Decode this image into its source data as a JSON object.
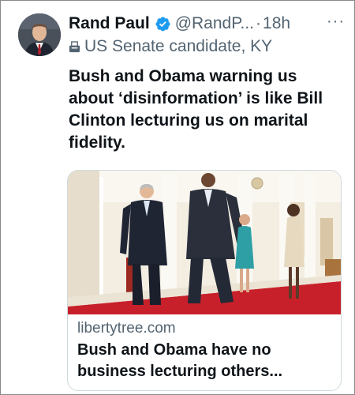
{
  "tweet": {
    "author_name": "Rand Paul",
    "handle": "@RandP...",
    "separator": "·",
    "time": "18h",
    "more_icon": "more-horizontal-icon",
    "verified_icon": "verified-badge-icon",
    "label_icon": "ballot-box-icon",
    "label": "US Senate candidate, KY",
    "text": "Bush and Obama warning us about ‘disinformation’ is like Bill Clinton lecturing us on marital fidelity."
  },
  "card": {
    "domain": "libertytree.com",
    "title": "Bush and Obama have no business lecturing others..."
  },
  "colors": {
    "verified": "#1d9bf0",
    "secondary_text": "#536471",
    "primary_text": "#0f1419",
    "border": "#cfd9de",
    "carpet": "#c8202a"
  }
}
